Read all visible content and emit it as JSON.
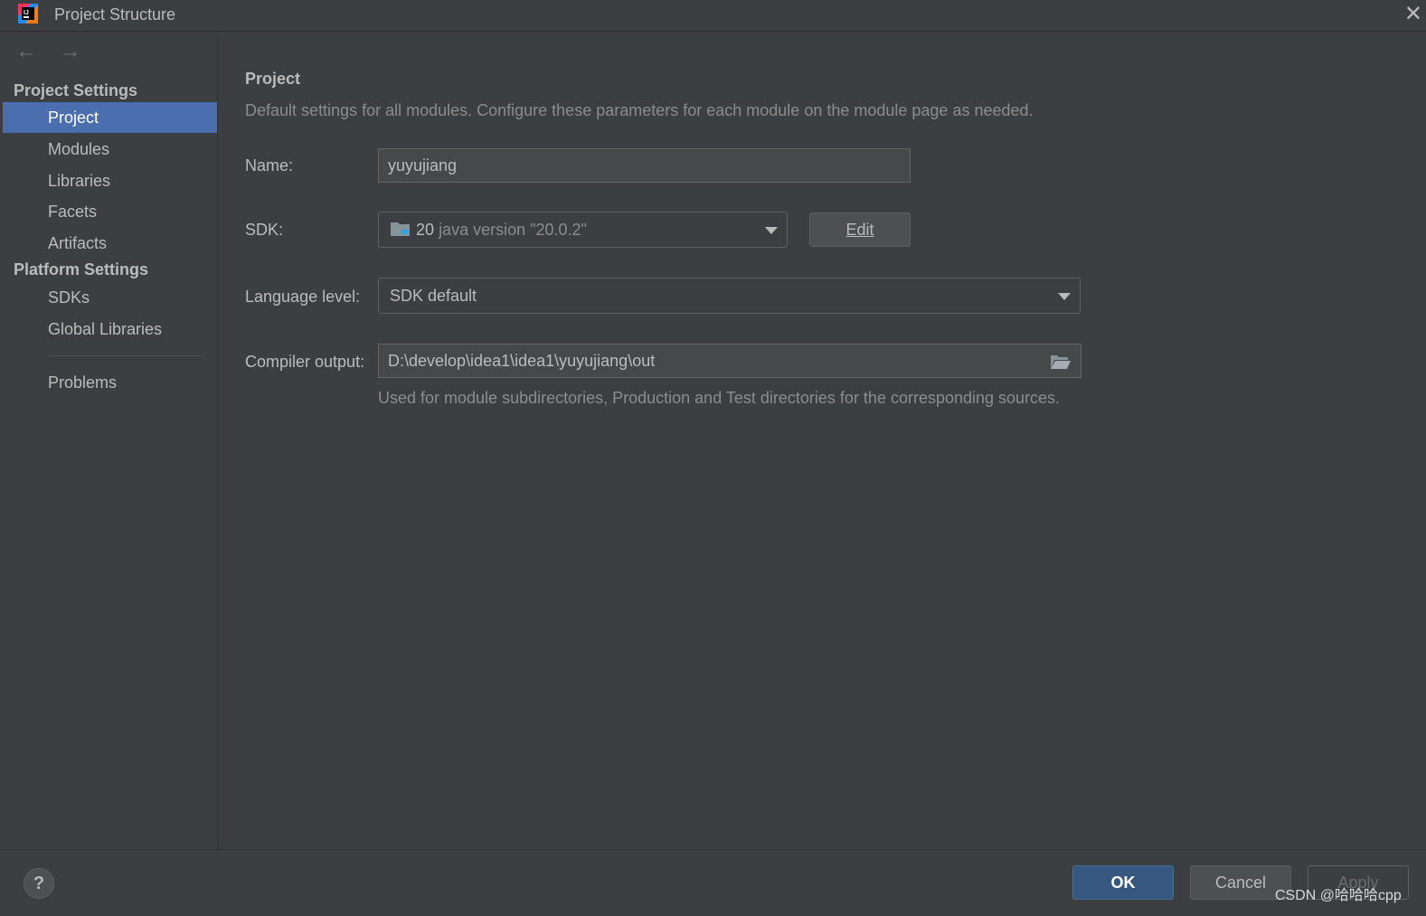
{
  "window": {
    "title": "Project Structure",
    "close_glyph": "✕",
    "app_icon": "intellij-idea-icon"
  },
  "nav": {
    "back": "←",
    "forward": "→"
  },
  "sidebar": {
    "project_settings_header": "Project Settings",
    "project_items": [
      "Project",
      "Modules",
      "Libraries",
      "Facets",
      "Artifacts"
    ],
    "platform_settings_header": "Platform Settings",
    "platform_items": [
      "SDKs",
      "Global Libraries"
    ],
    "problems": "Problems",
    "selected": "Project"
  },
  "main": {
    "title": "Project",
    "description": "Default settings for all modules. Configure these parameters for each module on the module page as needed.",
    "name_label": "Name:",
    "name_value": "yuyujiang",
    "sdk_label": "SDK:",
    "sdk_number": "20",
    "sdk_version": "java version \"20.0.2\"",
    "edit_button": "Edit",
    "language_label": "Language level:",
    "language_value": "SDK default",
    "compiler_label": "Compiler output:",
    "compiler_value": "D:\\develop\\idea1\\idea1\\yuyujiang\\out",
    "compiler_hint": "Used for module subdirectories, Production and Test directories for the corresponding sources."
  },
  "footer": {
    "help": "?",
    "ok": "OK",
    "cancel": "Cancel",
    "apply": "Apply",
    "watermark": "CSDN @哈哈哈cpp"
  },
  "colors": {
    "selection": "#4b6eaf",
    "ok_button": "#365880",
    "background": "#3c3f41"
  }
}
